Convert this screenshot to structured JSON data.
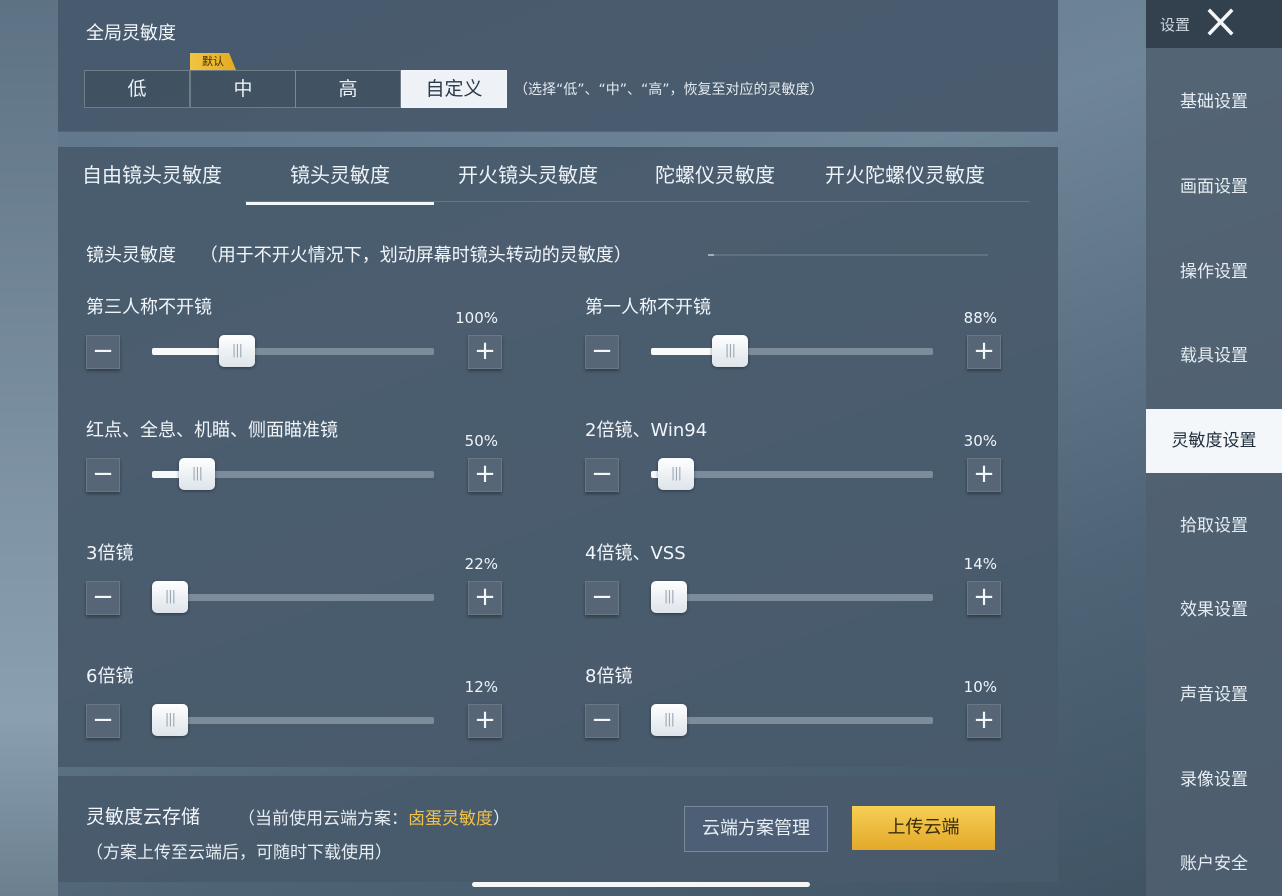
{
  "global": {
    "title": "全局灵敏度",
    "default_badge": "默认",
    "options": [
      "低",
      "中",
      "高",
      "自定义"
    ],
    "selected": "自定义",
    "hint": "（选择“低”、“中”、“高”，恢复至对应的灵敏度）"
  },
  "tabs": [
    "自由镜头灵敏度",
    "镜头灵敏度",
    "开火镜头灵敏度",
    "陀螺仪灵敏度",
    "开火陀螺仪灵敏度"
  ],
  "active_tab": "镜头灵敏度",
  "section": {
    "title": "镜头灵敏度",
    "desc": "（用于不开火情况下，划动屏幕时镜头转动的灵敏度）"
  },
  "sliders": [
    {
      "label": "第三人称不开镜",
      "value_text": "100%",
      "level": 0.3
    },
    {
      "label": "第一人称不开镜",
      "value_text": "88%",
      "level": 0.28
    },
    {
      "label": "红点、全息、机瞄、侧面瞄准镜",
      "value_text": "50%",
      "level": 0.16
    },
    {
      "label": "2倍镜、Win94",
      "value_text": "30%",
      "level": 0.09
    },
    {
      "label": "3倍镜",
      "value_text": "22%",
      "level": 0.06
    },
    {
      "label": "4倍镜、VSS",
      "value_text": "14%",
      "level": 0.03
    },
    {
      "label": "6倍镜",
      "value_text": "12%",
      "level": 0.02
    },
    {
      "label": "8倍镜",
      "value_text": "10%",
      "level": 0.02
    }
  ],
  "controls": {
    "minus": "−",
    "plus": "+",
    "knob_grip": "|||"
  },
  "cloud": {
    "title": "灵敏度云存储",
    "current_prefix": "（当前使用云端方案：",
    "current_plan": "卤蛋灵敏度",
    "current_suffix": "）",
    "note": "（方案上传至云端后，可随时下载使用）",
    "manage_button": "云端方案管理",
    "upload_button": "上传云端"
  },
  "sidebar": {
    "title": "设置",
    "items": [
      "基础设置",
      "画面设置",
      "操作设置",
      "载具设置",
      "灵敏度设置",
      "拾取设置",
      "效果设置",
      "声音设置",
      "录像设置",
      "账户安全"
    ],
    "active": "灵敏度设置"
  },
  "colors": {
    "accent_gold": "#f2c24a",
    "active_bg": "#f4f7fa"
  }
}
